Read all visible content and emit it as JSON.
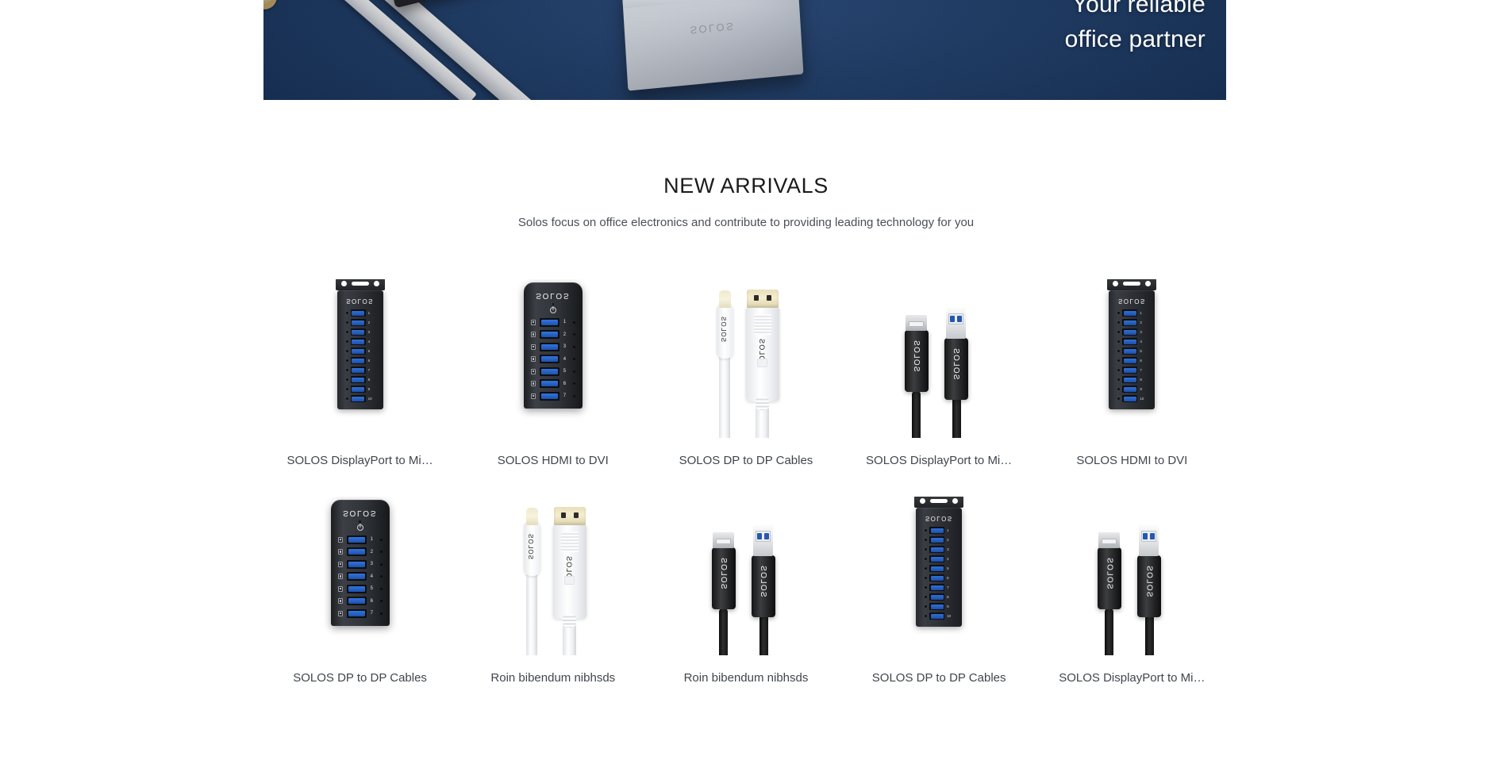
{
  "hero": {
    "line1": "Your reliable",
    "line2": "office partner",
    "card_brand": "SOLOS",
    "background_color": "#1a3a68",
    "text_color": "#ffffff"
  },
  "section": {
    "title": "NEW ARRIVALS",
    "subtitle": "Solos focus on office electronics and contribute to providing leading technology for you",
    "title_color": "#1b1b1b",
    "caption_color": "#41464d"
  },
  "brand": "SOLOS",
  "products": {
    "rows": [
      {
        "items": [
          {
            "label": "SOLOS DisplayPort to Mi…",
            "art": "hub-industrial"
          },
          {
            "label": "SOLOS HDMI to DVI",
            "art": "hub-rounded"
          },
          {
            "label": "SOLOS DP to DP Cables",
            "art": "cable-white"
          },
          {
            "label": "SOLOS DisplayPort to Mi…",
            "art": "cable-black"
          },
          {
            "label": "SOLOS HDMI to DVI",
            "art": "hub-industrial"
          }
        ]
      },
      {
        "items": [
          {
            "label": "SOLOS DP to DP Cables",
            "art": "hub-rounded"
          },
          {
            "label": "Roin bibendum nibhsds",
            "art": "cable-white"
          },
          {
            "label": "Roin bibendum nibhsds",
            "art": "cable-black"
          },
          {
            "label": "SOLOS DP to DP Cables",
            "art": "hub-industrial"
          },
          {
            "label": "SOLOS DisplayPort to Mi…",
            "art": "cable-black"
          }
        ]
      }
    ]
  },
  "port_numbers_10": [
    "1",
    "2",
    "3",
    "4",
    "5",
    "6",
    "7",
    "8",
    "9",
    "10"
  ],
  "port_numbers_6": [
    "1",
    "2",
    "3",
    "4",
    "5",
    "6",
    "7"
  ]
}
